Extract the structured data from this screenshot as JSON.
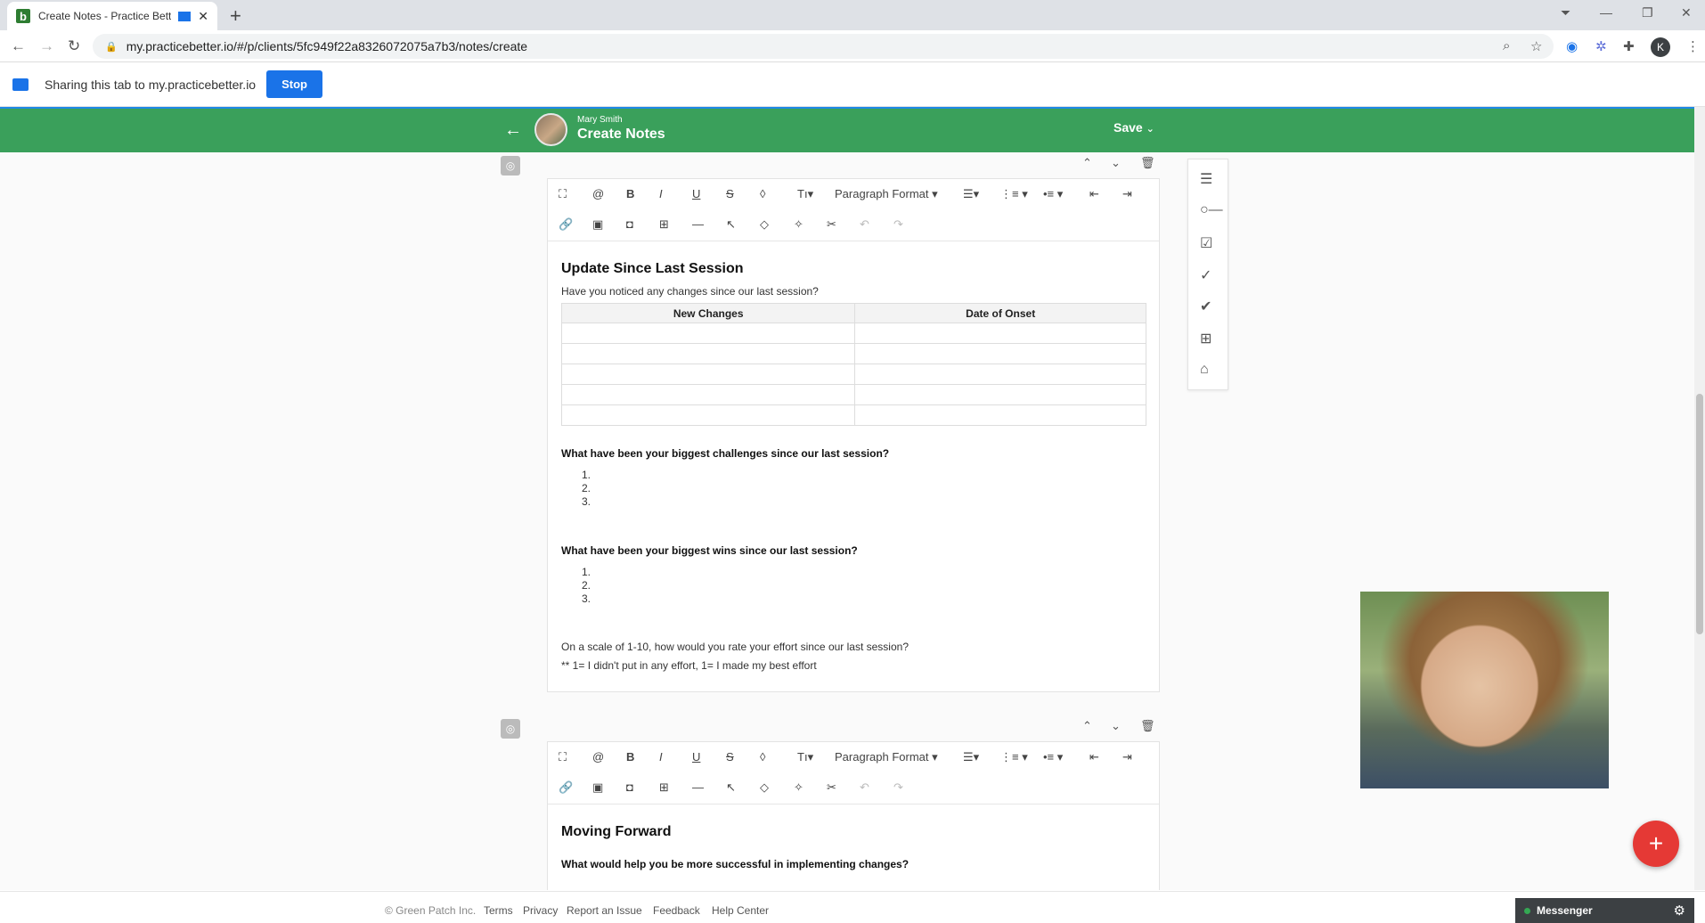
{
  "browser": {
    "tab_title": "Create Notes - Practice Bett",
    "url": "my.practicebetter.io/#/p/clients/5fc949f22a8326072075a7b3/notes/create",
    "profile_initial": "K"
  },
  "share_bar": {
    "text": "Sharing this tab to my.practicebetter.io",
    "stop_label": "Stop"
  },
  "header": {
    "client_name": "Mary Smith",
    "title": "Create Notes",
    "save_label": "Save"
  },
  "toolbar": {
    "paragraph_format": "Paragraph Format",
    "font_size": "Tı"
  },
  "section1": {
    "heading": "Update Since Last Session",
    "question": "Have you noticed any changes since our last session?",
    "table_headers": [
      "New Changes",
      "Date of Onset"
    ],
    "q2": "What have been your biggest challenges since our last session?",
    "list2": [
      "1.",
      "2.",
      "3."
    ],
    "q3": "What have been your biggest wins since our last session?",
    "list3": [
      "1.",
      "2.",
      "3."
    ],
    "scale_q": "On a scale of 1-10, how would you rate your effort since our last session?",
    "scale_note": "** 1= I didn't put in any effort, 1= I made my best effort"
  },
  "section2": {
    "heading": "Moving Forward",
    "question": "What would help you be more successful in implementing changes?"
  },
  "footer": {
    "copyright": "© Green Patch Inc.",
    "links": [
      "Terms",
      "Privacy",
      "Report an Issue",
      "Feedback",
      "Help Center"
    ]
  },
  "messenger": {
    "label": "Messenger"
  }
}
